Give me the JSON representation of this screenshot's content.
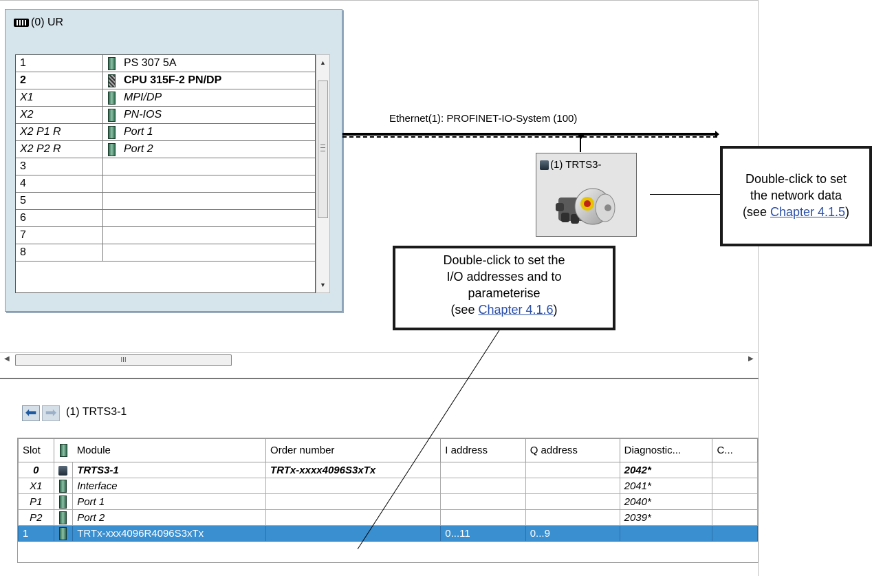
{
  "rack": {
    "title": "(0) UR",
    "rows": [
      {
        "slot": "1",
        "module": "PS 307 5A",
        "has_icon": true,
        "style": "normal",
        "icon": "module-icon"
      },
      {
        "slot": "2",
        "module": "CPU 315F-2 PN/DP",
        "has_icon": true,
        "style": "bold",
        "icon": "cpu-icon"
      },
      {
        "slot": "X1",
        "module": "MPI/DP",
        "has_icon": true,
        "style": "italic",
        "icon": "module-icon"
      },
      {
        "slot": "X2",
        "module": "PN-IOS",
        "has_icon": true,
        "style": "italic",
        "icon": "module-icon"
      },
      {
        "slot": "X2 P1 R",
        "module": "Port 1",
        "has_icon": true,
        "style": "italic",
        "icon": "module-icon"
      },
      {
        "slot": "X2 P2 R",
        "module": "Port 2",
        "has_icon": true,
        "style": "italic",
        "icon": "module-icon"
      },
      {
        "slot": "3",
        "module": "",
        "has_icon": false,
        "style": "normal"
      },
      {
        "slot": "4",
        "module": "",
        "has_icon": false,
        "style": "normal"
      },
      {
        "slot": "5",
        "module": "",
        "has_icon": false,
        "style": "normal"
      },
      {
        "slot": "6",
        "module": "",
        "has_icon": false,
        "style": "normal"
      },
      {
        "slot": "7",
        "module": "",
        "has_icon": false,
        "style": "normal"
      },
      {
        "slot": "8",
        "module": "",
        "has_icon": false,
        "style": "normal"
      }
    ]
  },
  "network": {
    "label": "Ethernet(1): PROFINET-IO-System (100)"
  },
  "device": {
    "label": "(1) TRTS3-",
    "icon": "io-device-icon"
  },
  "callouts": {
    "network": {
      "line1": "Double-click to set",
      "line2": "the network data",
      "prefix": "(see ",
      "link": "Chapter 4.1.5",
      "suffix": ")"
    },
    "io": {
      "line1": "Double-click to set the",
      "line2": "I/O addresses and to",
      "line3": "parameterise",
      "prefix": "(see ",
      "link": "Chapter 4.1.6",
      "suffix": ")"
    }
  },
  "scrollbar": {
    "thumb_grip": "III"
  },
  "detail": {
    "station_name": "(1)  TRTS3-1",
    "columns": [
      "Slot",
      "",
      "Module",
      "Order number",
      "I address",
      "Q address",
      "Diagnostic...",
      "C..."
    ],
    "rows": [
      {
        "slot": "0",
        "module": "TRTS3-1",
        "order": "TRTx-xxxx4096S3xTx",
        "i_addr": "",
        "q_addr": "",
        "diag": "2042*",
        "style": "bold",
        "icon": "device-icon"
      },
      {
        "slot": "X1",
        "module": "Interface",
        "order": "",
        "i_addr": "",
        "q_addr": "",
        "diag": "2041*",
        "style": "italic",
        "icon": "module-icon"
      },
      {
        "slot": "P1",
        "module": "Port 1",
        "order": "",
        "i_addr": "",
        "q_addr": "",
        "diag": "2040*",
        "style": "italic",
        "icon": "module-icon"
      },
      {
        "slot": "P2",
        "module": "Port 2",
        "order": "",
        "i_addr": "",
        "q_addr": "",
        "diag": "2039*",
        "style": "italic",
        "icon": "module-icon"
      },
      {
        "slot": "1",
        "module": "TRTx-xxx4096R4096S3xTx",
        "order": "",
        "i_addr": "0...11",
        "q_addr": "0...9",
        "diag": "",
        "style": "selected",
        "icon": "module-icon"
      }
    ]
  },
  "colors": {
    "selection": "#3a8fd0",
    "rack_bg": "#d6e4ec",
    "link": "#2a4fa8"
  }
}
